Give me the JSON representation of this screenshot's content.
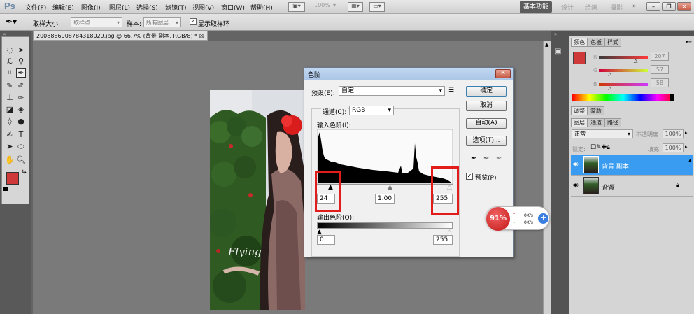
{
  "app": {
    "logo": "Ps"
  },
  "menu": [
    "文件(F)",
    "编辑(E)",
    "图像(I)",
    "图层(L)",
    "选择(S)",
    "滤镜(T)",
    "视图(V)",
    "窗口(W)",
    "帮助(H)"
  ],
  "menubar_controls": {
    "zoom": "100%"
  },
  "workspaces": [
    "基本功能",
    "设计",
    "绘画",
    "摄影",
    "»"
  ],
  "options_bar": {
    "sample_size_label": "取样大小:",
    "sample_size_value": "取样点",
    "sample_label": "样本:",
    "sample_value": "所有图层",
    "show_ring_label": "显示取样环",
    "show_ring_checked": true
  },
  "document": {
    "tab_title": "2008886908784318029.jpg @ 66.7% (背景 副本, RGB/8) * ☒"
  },
  "color_panel": {
    "tabs": [
      "颜色",
      "色板",
      "样式"
    ],
    "channels": [
      {
        "label": "R",
        "value": "207"
      },
      {
        "label": "G",
        "value": "57"
      },
      {
        "label": "B",
        "value": "58"
      }
    ],
    "foreground_color": "#cf393a"
  },
  "adjust_panel": {
    "tabs": [
      "调整",
      "蒙版"
    ]
  },
  "layers_panel": {
    "tabs": [
      "图层",
      "通道",
      "路径"
    ],
    "blend_mode": "正常",
    "opacity_label": "不透明度:",
    "opacity_value": "100%",
    "lock_label": "锁定:",
    "fill_label": "填充:",
    "fill_value": "100%",
    "layers": [
      {
        "name": "背景 副本",
        "selected": true
      },
      {
        "name": "背景",
        "selected": false
      }
    ]
  },
  "levels_dialog": {
    "title": "色阶",
    "preset_label": "预设(E):",
    "preset_value": "自定",
    "channel_label": "通道(C):",
    "channel_value": "RGB",
    "input_levels_label": "输入色阶(I):",
    "input_black": "24",
    "input_gamma": "1.00",
    "input_white": "255",
    "output_levels_label": "输出色阶(O):",
    "output_black": "0",
    "output_white": "255",
    "buttons": {
      "ok": "确定",
      "cancel": "取消",
      "auto": "自动(A)",
      "options": "选项(T)..."
    },
    "preview_label": "预览(P)",
    "preview_checked": true
  },
  "net_widget": {
    "percent": "91%",
    "up": "0K/s",
    "down": "0K/s"
  },
  "photo": {
    "caption": "Flying"
  }
}
